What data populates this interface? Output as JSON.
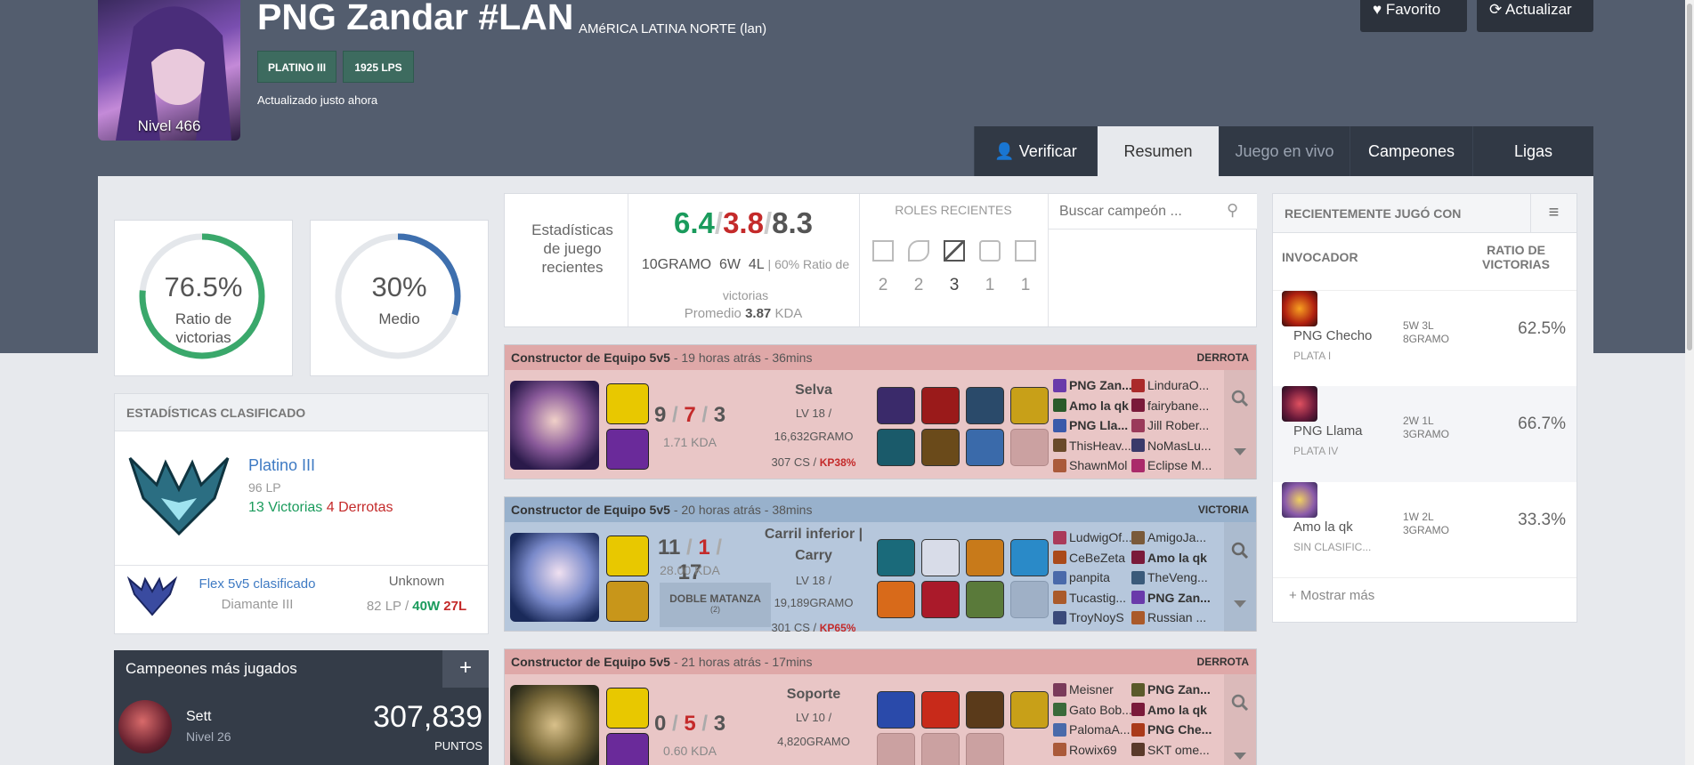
{
  "profile": {
    "name": "PNG Zandar #LAN",
    "region": "AMéRICA LATINA NORTE (lan)",
    "level": "Nivel 466",
    "rank_tag": "PLATINO III",
    "lp_tag": "1925 LPS",
    "updated": "Actualizado justo ahora"
  },
  "actions": {
    "favorite": "Favorito",
    "refresh": "Actualizar"
  },
  "tabs": {
    "verify": "Verificar",
    "summary": "Resumen",
    "live": "Juego en vivo",
    "champions": "Campeones",
    "leagues": "Ligas"
  },
  "winrate_card": {
    "value": "76.5%",
    "label1": "Ratio de",
    "label2": "victorias",
    "fraction": 0.765
  },
  "avg_card": {
    "value": "30%",
    "label": "Medio",
    "fraction": 0.3
  },
  "ranked": {
    "header": "ESTADÍSTICAS CLASIFICADO",
    "tier": "Platino III",
    "lp": "96 LP",
    "wins": "13 Victorias",
    "losses": "4 Derrotas",
    "flex_label": "Flex 5v5 clasificado",
    "flex_tier": "Diamante III",
    "flex_status": "Unknown",
    "flex_lp": "82 LP /",
    "flex_w": "40W",
    "flex_l": "27L"
  },
  "most_played": {
    "header": "Campeones más jugados",
    "plus": "+",
    "name": "Sett",
    "level": "Nivel 26",
    "points": "307,839",
    "points_label": "PUNTOS"
  },
  "stats": {
    "label": "Estadísticas de juego recientes",
    "k": "6.4",
    "d": "3.8",
    "a": "8.3",
    "games": "10GRAMO",
    "w": "6W",
    "l": "4L",
    "ratio": "| 60% Ratio de victorias",
    "avg_prefix": "Promedio",
    "avg": "3.87",
    "avg_suffix": "KDA",
    "slash": "/"
  },
  "roles": {
    "header": "ROLES RECIENTES",
    "counts": [
      "2",
      "2",
      "3",
      "1",
      "1"
    ]
  },
  "search": {
    "placeholder": "Buscar campeón ..."
  },
  "matches": [
    {
      "queue": "Constructor de Equipo 5v5",
      "sep": "-",
      "ago": "19 horas atrás",
      "dur": "36mins",
      "result": "DERROTA",
      "role": "Selva",
      "k": "9",
      "d": "7",
      "a": "3",
      "kda": "1.71 KDA",
      "lv": "LV 18 /",
      "gold": "16,632GRAMO",
      "cs": "307 CS /",
      "kp": "KP38%",
      "team1": [
        "PNG Zan...",
        "Amo la qk",
        "PNG Lla...",
        "ThisHeav...",
        "ShawnMol"
      ],
      "team2": [
        "LinduraO...",
        "fairybane...",
        "Jill Rober...",
        "NoMasLu...",
        "Eclipse M..."
      ]
    },
    {
      "queue": "Constructor de Equipo 5v5",
      "sep": "-",
      "ago": "20 horas atrás",
      "dur": "38mins",
      "result": "VICTORIA",
      "role": "Carril inferior | Carry",
      "k": "11",
      "d": "1",
      "a": "17",
      "kda": "28.00 KDA",
      "badge": "DOBLE MATANZA",
      "badge_sub": "(2)",
      "lv": "LV 18 /",
      "gold": "19,189GRAMO",
      "cs": "301 CS /",
      "kp": "KP65%",
      "team1": [
        "LudwigOf...",
        "CeBeZeta",
        "panpita",
        "Tucastig...",
        "TroyNoyS"
      ],
      "team2": [
        "AmigoJa...",
        "Amo la qk",
        "TheVeng...",
        "PNG Zan...",
        "Russian ..."
      ]
    },
    {
      "queue": "Constructor de Equipo 5v5",
      "sep": "-",
      "ago": "21 horas atrás",
      "dur": "17mins",
      "result": "DERROTA",
      "role": "Soporte",
      "k": "0",
      "d": "5",
      "a": "3",
      "kda": "0.60 KDA",
      "lv": "LV 10 /",
      "gold": "4,820GRAMO",
      "team1": [
        "Meisner",
        "Gato Bob...",
        "PalomaA...",
        "Rowix69"
      ],
      "team2": [
        "PNG Zan...",
        "Amo la qk",
        "PNG Che...",
        "SKT ome..."
      ]
    }
  ],
  "recent": {
    "header": "RECIENTEMENTE JUGÓ CON",
    "col1": "INVOCADOR",
    "col2a": "RATIO DE",
    "col2b": "VICTORIAS",
    "more": "+ Mostrar más",
    "rows": [
      {
        "name": "PNG Checho",
        "tier": "PLATA I",
        "wl": "5W 3L",
        "g": "8GRAMO",
        "ratio": "62.5%"
      },
      {
        "name": "PNG Llama",
        "tier": "PLATA IV",
        "wl": "2W 1L",
        "g": "3GRAMO",
        "ratio": "66.7%"
      },
      {
        "name": "Amo la qk",
        "tier": "SIN CLASIFIC...",
        "wl": "1W 2L",
        "g": "3GRAMO",
        "ratio": "33.3%"
      }
    ]
  },
  "colors": {
    "header": "#535d6e",
    "win": "#b6c7dc",
    "loss": "#e9c6c6",
    "green": "#1a9b5c",
    "red": "#c42a2a",
    "blue": "#3e7ac3",
    "ring_green": "#3aa86b",
    "ring_blue": "#3e6fae"
  }
}
